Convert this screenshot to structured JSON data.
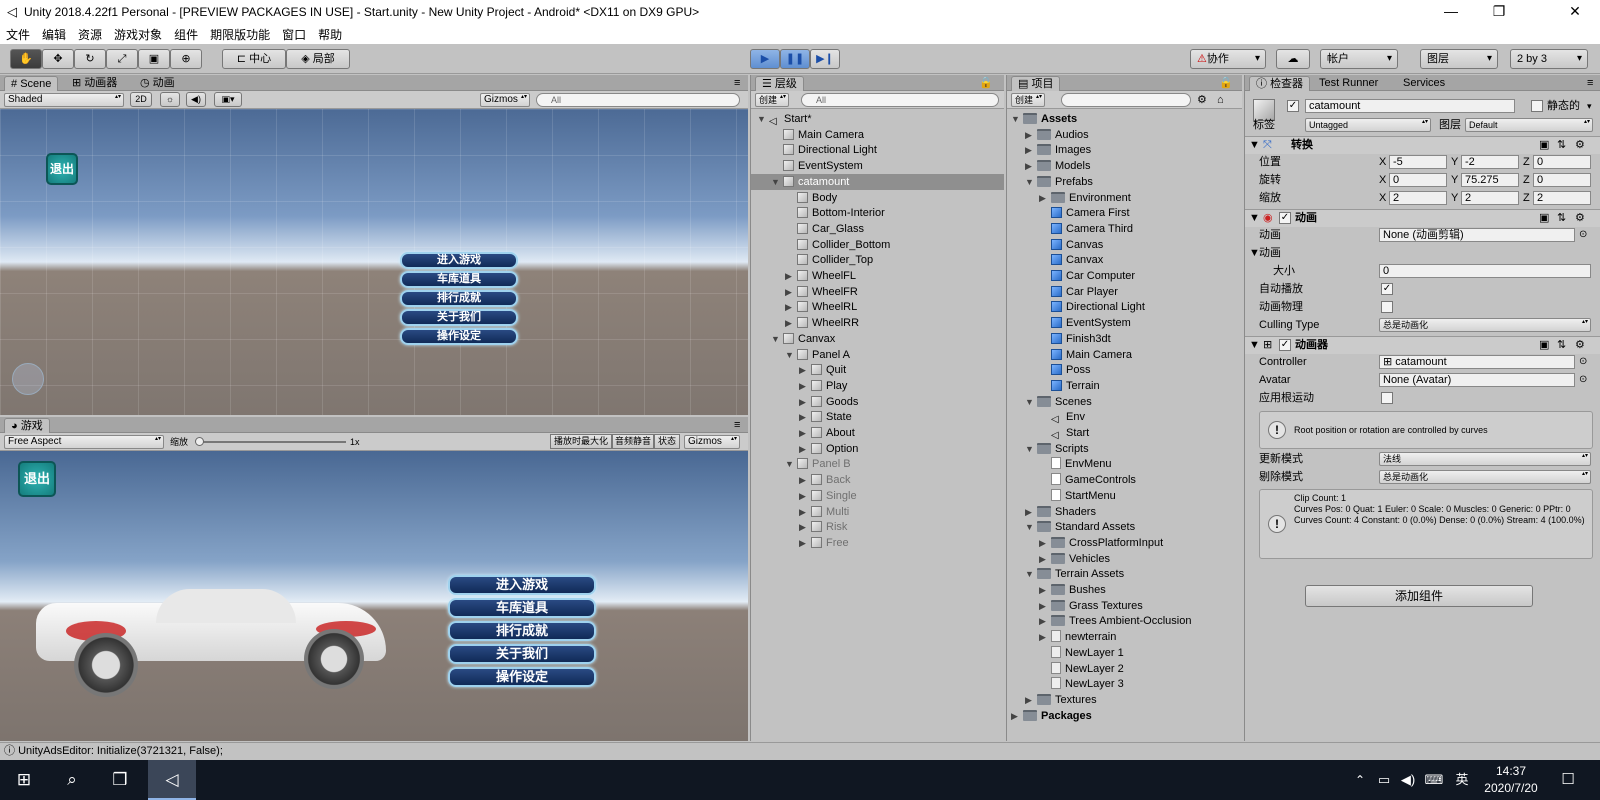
{
  "window": {
    "title": "Unity 2018.4.22f1 Personal - [PREVIEW PACKAGES IN USE] - Start.unity - New Unity Project - Android* <DX11 on DX9 GPU>",
    "controls": [
      "—",
      "❐",
      "✕"
    ]
  },
  "menu": [
    "文件",
    "编辑",
    "资源",
    "游戏对象",
    "组件",
    "期限版功能",
    "窗口",
    "帮助"
  ],
  "toolbar": {
    "tools": [
      "hand",
      "move",
      "rotate",
      "scale",
      "rect",
      "transform"
    ],
    "pivot": "中心",
    "space": "局部",
    "collab": "协作",
    "account": "帐户",
    "layers": "图层",
    "layout": "2 by 3"
  },
  "scene": {
    "tabs": [
      "Scene",
      "动画器",
      "动画"
    ],
    "shading": "Shaded",
    "mode2d": "2D",
    "gizmos": "Gizmos",
    "search_placeholder": "All",
    "exit_label": "退出",
    "menu_buttons": [
      "进入游戏",
      "车库道具",
      "排行成就",
      "关于我们",
      "操作设定"
    ]
  },
  "game": {
    "tab": "游戏",
    "aspect": "Free Aspect",
    "scale_label": "缩放",
    "scale_value": "1x",
    "maximize": "播放时最大化",
    "mute": "音频静音",
    "stats": "状态",
    "gizmos": "Gizmos",
    "exit_label": "退出",
    "menu_buttons": [
      "进入游戏",
      "车库道具",
      "排行成就",
      "关于我们",
      "操作设定"
    ]
  },
  "hierarchy": {
    "tab": "层级",
    "create": "创建",
    "search_placeholder": "All",
    "items": [
      {
        "label": "Start*",
        "depth": 0,
        "kind": "scene",
        "open": true
      },
      {
        "label": "Main Camera",
        "depth": 1,
        "kind": "go"
      },
      {
        "label": "Directional Light",
        "depth": 1,
        "kind": "go"
      },
      {
        "label": "EventSystem",
        "depth": 1,
        "kind": "go"
      },
      {
        "label": "catamount",
        "depth": 1,
        "kind": "go",
        "open": true,
        "selected": true
      },
      {
        "label": "Body",
        "depth": 2,
        "kind": "go"
      },
      {
        "label": "Bottom-Interior",
        "depth": 2,
        "kind": "go"
      },
      {
        "label": "Car_Glass",
        "depth": 2,
        "kind": "go"
      },
      {
        "label": "Collider_Bottom",
        "depth": 2,
        "kind": "go"
      },
      {
        "label": "Collider_Top",
        "depth": 2,
        "kind": "go"
      },
      {
        "label": "WheelFL",
        "depth": 2,
        "kind": "go",
        "closed": true
      },
      {
        "label": "WheelFR",
        "depth": 2,
        "kind": "go",
        "closed": true
      },
      {
        "label": "WheelRL",
        "depth": 2,
        "kind": "go",
        "closed": true
      },
      {
        "label": "WheelRR",
        "depth": 2,
        "kind": "go",
        "closed": true
      },
      {
        "label": "Canvax",
        "depth": 1,
        "kind": "go",
        "open": true
      },
      {
        "label": "Panel A",
        "depth": 2,
        "kind": "go",
        "open": true
      },
      {
        "label": "Quit",
        "depth": 3,
        "kind": "go",
        "closed": true
      },
      {
        "label": "Play",
        "depth": 3,
        "kind": "go",
        "closed": true
      },
      {
        "label": "Goods",
        "depth": 3,
        "kind": "go",
        "closed": true
      },
      {
        "label": "State",
        "depth": 3,
        "kind": "go",
        "closed": true
      },
      {
        "label": "About",
        "depth": 3,
        "kind": "go",
        "closed": true
      },
      {
        "label": "Option",
        "depth": 3,
        "kind": "go",
        "closed": true
      },
      {
        "label": "Panel B",
        "depth": 2,
        "kind": "go",
        "open": true,
        "dim": true
      },
      {
        "label": "Back",
        "depth": 3,
        "kind": "go",
        "closed": true,
        "dim": true
      },
      {
        "label": "Single",
        "depth": 3,
        "kind": "go",
        "closed": true,
        "dim": true
      },
      {
        "label": "Multi",
        "depth": 3,
        "kind": "go",
        "closed": true,
        "dim": true
      },
      {
        "label": "Risk",
        "depth": 3,
        "kind": "go",
        "closed": true,
        "dim": true
      },
      {
        "label": "Free",
        "depth": 3,
        "kind": "go",
        "closed": true,
        "dim": true
      }
    ]
  },
  "project": {
    "tab": "项目",
    "create": "创建",
    "items": [
      {
        "label": "Assets",
        "depth": 0,
        "kind": "folder",
        "open": true,
        "bold": true
      },
      {
        "label": "Audios",
        "depth": 1,
        "kind": "folder",
        "closed": true
      },
      {
        "label": "Images",
        "depth": 1,
        "kind": "folder",
        "closed": true
      },
      {
        "label": "Models",
        "depth": 1,
        "kind": "folder",
        "closed": true
      },
      {
        "label": "Prefabs",
        "depth": 1,
        "kind": "folder",
        "open": true
      },
      {
        "label": "Environment",
        "depth": 2,
        "kind": "folder",
        "closed": true
      },
      {
        "label": "Camera First",
        "depth": 2,
        "kind": "prefab"
      },
      {
        "label": "Camera Third",
        "depth": 2,
        "kind": "prefab"
      },
      {
        "label": "Canvas",
        "depth": 2,
        "kind": "prefab"
      },
      {
        "label": "Canvax",
        "depth": 2,
        "kind": "prefab"
      },
      {
        "label": "Car Computer",
        "depth": 2,
        "kind": "prefab"
      },
      {
        "label": "Car Player",
        "depth": 2,
        "kind": "prefab"
      },
      {
        "label": "Directional Light",
        "depth": 2,
        "kind": "prefab"
      },
      {
        "label": "EventSystem",
        "depth": 2,
        "kind": "prefab"
      },
      {
        "label": "Finish3dt",
        "depth": 2,
        "kind": "prefab"
      },
      {
        "label": "Main Camera",
        "depth": 2,
        "kind": "prefab"
      },
      {
        "label": "Poss",
        "depth": 2,
        "kind": "prefab"
      },
      {
        "label": "Terrain",
        "depth": 2,
        "kind": "prefab"
      },
      {
        "label": "Scenes",
        "depth": 1,
        "kind": "folder",
        "open": true
      },
      {
        "label": "Env",
        "depth": 2,
        "kind": "scene"
      },
      {
        "label": "Start",
        "depth": 2,
        "kind": "scene"
      },
      {
        "label": "Scripts",
        "depth": 1,
        "kind": "folder",
        "open": true
      },
      {
        "label": "EnvMenu",
        "depth": 2,
        "kind": "script"
      },
      {
        "label": "GameControls",
        "depth": 2,
        "kind": "script"
      },
      {
        "label": "StartMenu",
        "depth": 2,
        "kind": "script"
      },
      {
        "label": "Shaders",
        "depth": 1,
        "kind": "folder",
        "closed": true
      },
      {
        "label": "Standard Assets",
        "depth": 1,
        "kind": "folder",
        "open": true
      },
      {
        "label": "CrossPlatformInput",
        "depth": 2,
        "kind": "folder",
        "closed": true
      },
      {
        "label": "Vehicles",
        "depth": 2,
        "kind": "folder",
        "closed": true
      },
      {
        "label": "Terrain Assets",
        "depth": 1,
        "kind": "folder",
        "open": true
      },
      {
        "label": "Bushes",
        "depth": 2,
        "kind": "folder",
        "closed": true
      },
      {
        "label": "Grass Textures",
        "depth": 2,
        "kind": "folder",
        "closed": true
      },
      {
        "label": "Trees Ambient-Occlusion",
        "depth": 2,
        "kind": "folder",
        "closed": true
      },
      {
        "label": "newterrain",
        "depth": 2,
        "kind": "asset",
        "closed": true
      },
      {
        "label": "NewLayer 1",
        "depth": 2,
        "kind": "asset"
      },
      {
        "label": "NewLayer 2",
        "depth": 2,
        "kind": "asset"
      },
      {
        "label": "NewLayer 3",
        "depth": 2,
        "kind": "asset"
      },
      {
        "label": "Textures",
        "depth": 1,
        "kind": "folder",
        "closed": true
      },
      {
        "label": "Packages",
        "depth": 0,
        "kind": "folder",
        "closed": true,
        "bold": true
      }
    ]
  },
  "inspector": {
    "tabs": [
      "检查器",
      "Test Runner",
      "Services"
    ],
    "object_name": "catamount",
    "static_label": "静态的",
    "tag_label": "标签",
    "tag_value": "Untagged",
    "layer_label": "图层",
    "layer_value": "Default",
    "transform": {
      "title": "转换",
      "rows": [
        {
          "label": "位置",
          "x": "-5",
          "y": "-2",
          "z": "0"
        },
        {
          "label": "旋转",
          "x": "0",
          "y": "75.275",
          "z": "0"
        },
        {
          "label": "缩放",
          "x": "2",
          "y": "2",
          "z": "2"
        }
      ]
    },
    "animation": {
      "title": "动画",
      "clip_label": "动画",
      "clip_value": "None (动画剪辑)",
      "list_label": "动画",
      "size_label": "大小",
      "size_value": "0",
      "autoplay_label": "自动播放",
      "physics_label": "动画物理",
      "culling_label": "Culling Type",
      "culling_value": "总是动画化"
    },
    "animator": {
      "title": "动画器",
      "controller_label": "Controller",
      "controller_value": "catamount",
      "avatar_label": "Avatar",
      "avatar_value": "None (Avatar)",
      "root_label": "应用根运动",
      "root_help": "Root position or rotation are controlled by curves",
      "update_label": "更新模式",
      "update_value": "法线",
      "cull_label": "剔除模式",
      "cull_value": "总是动画化",
      "info": "Clip Count: 1\nCurves Pos: 0 Quat: 1 Euler: 0 Scale: 0 Muscles: 0 Generic: 0 PPtr: 0\nCurves Count: 4 Constant: 0 (0.0%) Dense: 0 (0.0%) Stream: 4 (100.0%)"
    },
    "add_component": "添加组件"
  },
  "status": "UnityAdsEditor: Initialize(3721321, False);",
  "taskbar": {
    "time": "14:37",
    "date": "2020/7/20",
    "ime": "英"
  },
  "colors": {
    "accent": "#5f8fd1",
    "selection": "#8f8f8f",
    "panel": "#c2c2c2",
    "taskbar": "#101722"
  }
}
